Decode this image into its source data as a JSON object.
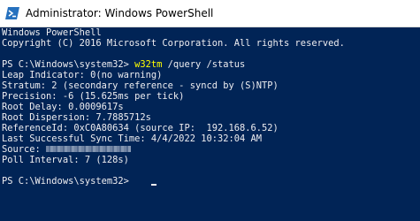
{
  "window": {
    "title": "Administrator: Windows PowerShell",
    "icon": "powershell-icon"
  },
  "console": {
    "banner_1": "Windows PowerShell",
    "banner_2": "Copyright (C) 2016 Microsoft Corporation. All rights reserved.",
    "prompt_1": "PS C:\\Windows\\system32> ",
    "command_name": "w32tm",
    "command_args": " /query /status",
    "out_leap": "Leap Indicator: 0(no warning)",
    "out_stratum": "Stratum: 2 (secondary reference - syncd by (S)NTP)",
    "out_precision": "Precision: -6 (15.625ms per tick)",
    "out_root_delay": "Root Delay: 0.0009617s",
    "out_root_dispersion": "Root Dispersion: 7.7885712s",
    "out_reference_id": "ReferenceId: 0xC0A80634 (source IP:  192.168.6.52)",
    "out_last_sync": "Last Successful Sync Time: 4/4/2022 10:32:04 AM",
    "out_source_label": "Source: ",
    "out_poll": "Poll Interval: 7 (128s)",
    "prompt_2": "PS C:\\Windows\\system32> "
  },
  "colors": {
    "console_background": "#012456",
    "console_text": "#eeedf0",
    "command_highlight": "#ffff00",
    "titlebar_background": "#ffffff"
  }
}
